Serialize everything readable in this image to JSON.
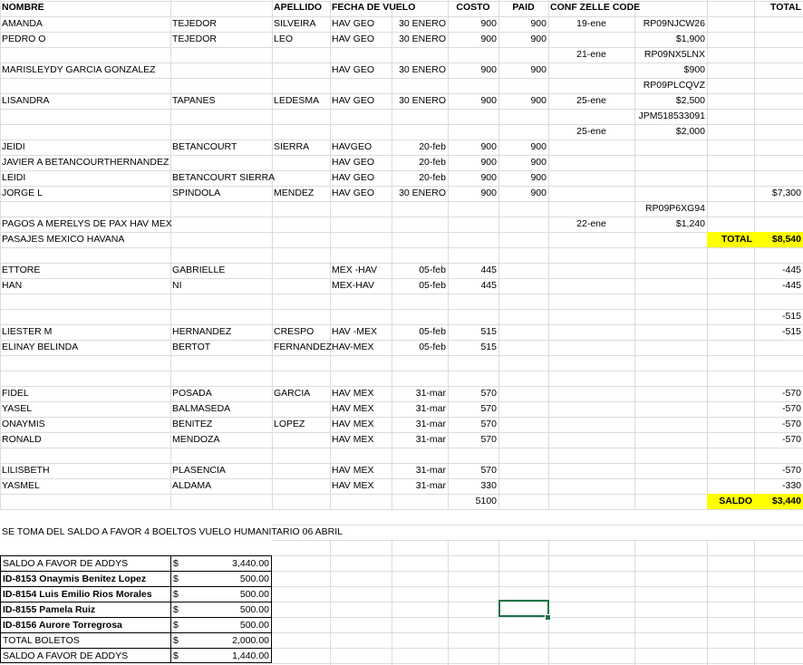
{
  "headers": [
    "NOMBRE",
    "APELLIDO",
    "FECHA DE VUELO",
    "COSTO",
    "PAID",
    "CONF ZELLE CODE",
    "TOTAL"
  ],
  "rows": [
    {
      "r": 1,
      "A": "AMANDA",
      "B": "TEJEDOR",
      "C": "SILVEIRA",
      "D": "HAV GEO",
      "E": "30 ENERO",
      "F": "900",
      "G": "900",
      "H": "19-ene",
      "I": "RP09NJCW26"
    },
    {
      "r": 2,
      "A": "PEDRO O",
      "B": "TEJEDOR",
      "C": "LEO",
      "D": "HAV GEO",
      "E": "30 ENERO",
      "F": "900",
      "G": "900",
      "I": "$1,900"
    },
    {
      "r": 3,
      "H": "21-ene",
      "I": "RP09NX5LNX"
    },
    {
      "r": 4,
      "A": "MARISLEYDY GARCIA GONZALEZ",
      "D": "HAV GEO",
      "E": "30 ENERO",
      "F": "900",
      "G": "900",
      "I": "$900"
    },
    {
      "r": 5,
      "I": "RP09PLCQVZ"
    },
    {
      "r": 6,
      "A": "LISANDRA",
      "B": "TAPANES",
      "C": "LEDESMA",
      "D": "HAV GEO",
      "E": "30 ENERO",
      "F": "900",
      "G": "900",
      "H": "25-ene",
      "I": "$2,500"
    },
    {
      "r": 7,
      "I": "JPM518533091"
    },
    {
      "r": 8,
      "H": "25-ene",
      "I": "$2,000"
    },
    {
      "r": 9,
      "A": "JEIDI",
      "B": "BETANCOURT",
      "C": "SIERRA",
      "D": "HAVGEO",
      "E": "20-feb",
      "F": "900",
      "G": "900"
    },
    {
      "r": 10,
      "A": "JAVIER A BETANCOURTHERNANDEZ",
      "D": "HAV GEO",
      "E": "20-feb",
      "F": "900",
      "G": "900"
    },
    {
      "r": 11,
      "A": "LEIDI",
      "B": "BETANCOURT SIERRA",
      "D": "HAV GEO",
      "E": "20-feb",
      "F": "900",
      "G": "900"
    },
    {
      "r": 12,
      "A": "JORGE L",
      "B": "SPINDOLA",
      "C": "MENDEZ",
      "D": "HAV GEO",
      "E": "30  ENERO",
      "F": "900",
      "G": "900",
      "K": "$7,300"
    },
    {
      "r": 13,
      "I": "RP09P6XG94"
    },
    {
      "r": 14,
      "A": "PAGOS  A MERELYS DE PAX HAV MEX",
      "H": "22-ene",
      "I": "$1,240"
    },
    {
      "r": 15,
      "A": "PASAJES MEXICO HAVANA",
      "J": "TOTAL",
      "K": "$8,540"
    },
    {
      "r": 17,
      "A": "ETTORE",
      "B": "GABRIELLE",
      "D": "MEX -HAV",
      "E": "05-feb",
      "F": "445",
      "K": "-445"
    },
    {
      "r": 18,
      "A": "HAN",
      "B": "NI",
      "D": "MEX-HAV",
      "E": "05-feb",
      "F": "445",
      "K": "-445"
    },
    {
      "r": 20,
      "K": "-515"
    },
    {
      "r": 21,
      "A": "LIESTER M",
      "B": "HERNANDEZ",
      "C": "CRESPO",
      "D": "HAV -MEX",
      "E": "05-feb",
      "F": "515",
      "K": "-515"
    },
    {
      "r": 22,
      "A": "ELINAY BELINDA",
      "B": "BERTOT",
      "C": "FERNANDEZ",
      "D": "HAV-MEX",
      "E": "05-feb",
      "F": "515"
    },
    {
      "r": 25,
      "A": "FIDEL",
      "B": "POSADA",
      "C": "GARCIA",
      "D": "HAV MEX",
      "E": "31-mar",
      "F": "570",
      "K": "-570"
    },
    {
      "r": 26,
      "A": "YASEL",
      "B": "BALMASEDA",
      "D": "HAV MEX",
      "E": "31-mar",
      "F": "570",
      "K": "-570"
    },
    {
      "r": 27,
      "A": "ONAYMIS",
      "B": "BENITEZ",
      "C": "LOPEZ",
      "D": "HAV MEX",
      "E": "31-mar",
      "F": "570",
      "K": "-570"
    },
    {
      "r": 28,
      "A": "RONALD",
      "B": "MENDOZA",
      "D": "HAV MEX",
      "E": "31-mar",
      "F": "570",
      "K": "-570"
    },
    {
      "r": 30,
      "A": "LILISBETH",
      "B": "PLASENCIA",
      "D": "HAV MEX",
      "E": "31-mar",
      "F": "570",
      "K": "-570"
    },
    {
      "r": 31,
      "A": "YASMEL",
      "B": "ALDAMA",
      "D": "HAV MEX",
      "E": "31-mar",
      "F": "330",
      "K": "-330"
    },
    {
      "r": 32,
      "F": "5100",
      "J": "SALDO",
      "K": "$3,440"
    }
  ],
  "note": "SE TOMA DEL SALDO A FAVOR 4 BOELTOS VUELO HUMANITARIO 06 ABRIL",
  "summary": [
    {
      "label": "SALDO A FAVOR DE ADDYS",
      "currency": "$",
      "amount": "3,440.00",
      "bold": false
    },
    {
      "label": "ID-8153 Onaymis Benitez Lopez",
      "currency": "$",
      "amount": "500.00",
      "bold": true
    },
    {
      "label": "ID-8154 Luis Emilio Rios Morales",
      "currency": "$",
      "amount": "500.00",
      "bold": true
    },
    {
      "label": "ID-8155 Pamela Ruiz",
      "currency": "$",
      "amount": "500.00",
      "bold": true
    },
    {
      "label": "ID-8156 Aurore Torregrosa",
      "currency": "$",
      "amount": "500.00",
      "bold": true
    },
    {
      "label": "TOTAL BOLETOS",
      "currency": "$",
      "amount": "2,000.00",
      "bold": false
    },
    {
      "label": "SALDO A FAVOR DE ADDYS",
      "currency": "$",
      "amount": "1,440.00",
      "bold": false
    }
  ],
  "colors": {
    "grid": "#dadcdf",
    "highlight": "#ffff00",
    "selection": "#217346"
  }
}
